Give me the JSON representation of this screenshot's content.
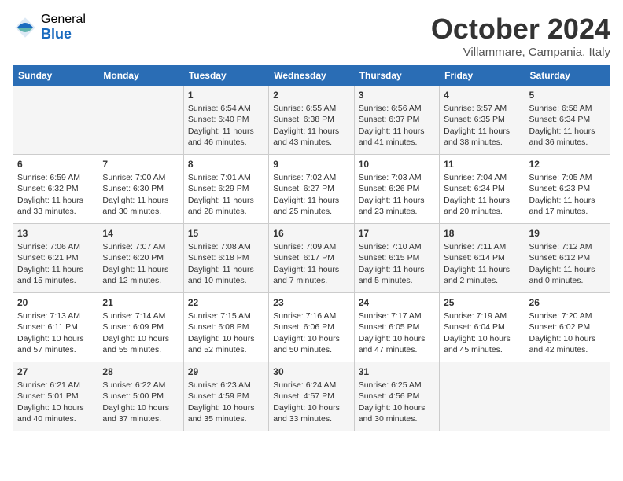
{
  "logo": {
    "general": "General",
    "blue": "Blue"
  },
  "title": "October 2024",
  "location": "Villammare, Campania, Italy",
  "days_of_week": [
    "Sunday",
    "Monday",
    "Tuesday",
    "Wednesday",
    "Thursday",
    "Friday",
    "Saturday"
  ],
  "weeks": [
    [
      {
        "day": "",
        "content": ""
      },
      {
        "day": "",
        "content": ""
      },
      {
        "day": "1",
        "content": "Sunrise: 6:54 AM\nSunset: 6:40 PM\nDaylight: 11 hours and 46 minutes."
      },
      {
        "day": "2",
        "content": "Sunrise: 6:55 AM\nSunset: 6:38 PM\nDaylight: 11 hours and 43 minutes."
      },
      {
        "day": "3",
        "content": "Sunrise: 6:56 AM\nSunset: 6:37 PM\nDaylight: 11 hours and 41 minutes."
      },
      {
        "day": "4",
        "content": "Sunrise: 6:57 AM\nSunset: 6:35 PM\nDaylight: 11 hours and 38 minutes."
      },
      {
        "day": "5",
        "content": "Sunrise: 6:58 AM\nSunset: 6:34 PM\nDaylight: 11 hours and 36 minutes."
      }
    ],
    [
      {
        "day": "6",
        "content": "Sunrise: 6:59 AM\nSunset: 6:32 PM\nDaylight: 11 hours and 33 minutes."
      },
      {
        "day": "7",
        "content": "Sunrise: 7:00 AM\nSunset: 6:30 PM\nDaylight: 11 hours and 30 minutes."
      },
      {
        "day": "8",
        "content": "Sunrise: 7:01 AM\nSunset: 6:29 PM\nDaylight: 11 hours and 28 minutes."
      },
      {
        "day": "9",
        "content": "Sunrise: 7:02 AM\nSunset: 6:27 PM\nDaylight: 11 hours and 25 minutes."
      },
      {
        "day": "10",
        "content": "Sunrise: 7:03 AM\nSunset: 6:26 PM\nDaylight: 11 hours and 23 minutes."
      },
      {
        "day": "11",
        "content": "Sunrise: 7:04 AM\nSunset: 6:24 PM\nDaylight: 11 hours and 20 minutes."
      },
      {
        "day": "12",
        "content": "Sunrise: 7:05 AM\nSunset: 6:23 PM\nDaylight: 11 hours and 17 minutes."
      }
    ],
    [
      {
        "day": "13",
        "content": "Sunrise: 7:06 AM\nSunset: 6:21 PM\nDaylight: 11 hours and 15 minutes."
      },
      {
        "day": "14",
        "content": "Sunrise: 7:07 AM\nSunset: 6:20 PM\nDaylight: 11 hours and 12 minutes."
      },
      {
        "day": "15",
        "content": "Sunrise: 7:08 AM\nSunset: 6:18 PM\nDaylight: 11 hours and 10 minutes."
      },
      {
        "day": "16",
        "content": "Sunrise: 7:09 AM\nSunset: 6:17 PM\nDaylight: 11 hours and 7 minutes."
      },
      {
        "day": "17",
        "content": "Sunrise: 7:10 AM\nSunset: 6:15 PM\nDaylight: 11 hours and 5 minutes."
      },
      {
        "day": "18",
        "content": "Sunrise: 7:11 AM\nSunset: 6:14 PM\nDaylight: 11 hours and 2 minutes."
      },
      {
        "day": "19",
        "content": "Sunrise: 7:12 AM\nSunset: 6:12 PM\nDaylight: 11 hours and 0 minutes."
      }
    ],
    [
      {
        "day": "20",
        "content": "Sunrise: 7:13 AM\nSunset: 6:11 PM\nDaylight: 10 hours and 57 minutes."
      },
      {
        "day": "21",
        "content": "Sunrise: 7:14 AM\nSunset: 6:09 PM\nDaylight: 10 hours and 55 minutes."
      },
      {
        "day": "22",
        "content": "Sunrise: 7:15 AM\nSunset: 6:08 PM\nDaylight: 10 hours and 52 minutes."
      },
      {
        "day": "23",
        "content": "Sunrise: 7:16 AM\nSunset: 6:06 PM\nDaylight: 10 hours and 50 minutes."
      },
      {
        "day": "24",
        "content": "Sunrise: 7:17 AM\nSunset: 6:05 PM\nDaylight: 10 hours and 47 minutes."
      },
      {
        "day": "25",
        "content": "Sunrise: 7:19 AM\nSunset: 6:04 PM\nDaylight: 10 hours and 45 minutes."
      },
      {
        "day": "26",
        "content": "Sunrise: 7:20 AM\nSunset: 6:02 PM\nDaylight: 10 hours and 42 minutes."
      }
    ],
    [
      {
        "day": "27",
        "content": "Sunrise: 6:21 AM\nSunset: 5:01 PM\nDaylight: 10 hours and 40 minutes."
      },
      {
        "day": "28",
        "content": "Sunrise: 6:22 AM\nSunset: 5:00 PM\nDaylight: 10 hours and 37 minutes."
      },
      {
        "day": "29",
        "content": "Sunrise: 6:23 AM\nSunset: 4:59 PM\nDaylight: 10 hours and 35 minutes."
      },
      {
        "day": "30",
        "content": "Sunrise: 6:24 AM\nSunset: 4:57 PM\nDaylight: 10 hours and 33 minutes."
      },
      {
        "day": "31",
        "content": "Sunrise: 6:25 AM\nSunset: 4:56 PM\nDaylight: 10 hours and 30 minutes."
      },
      {
        "day": "",
        "content": ""
      },
      {
        "day": "",
        "content": ""
      }
    ]
  ]
}
